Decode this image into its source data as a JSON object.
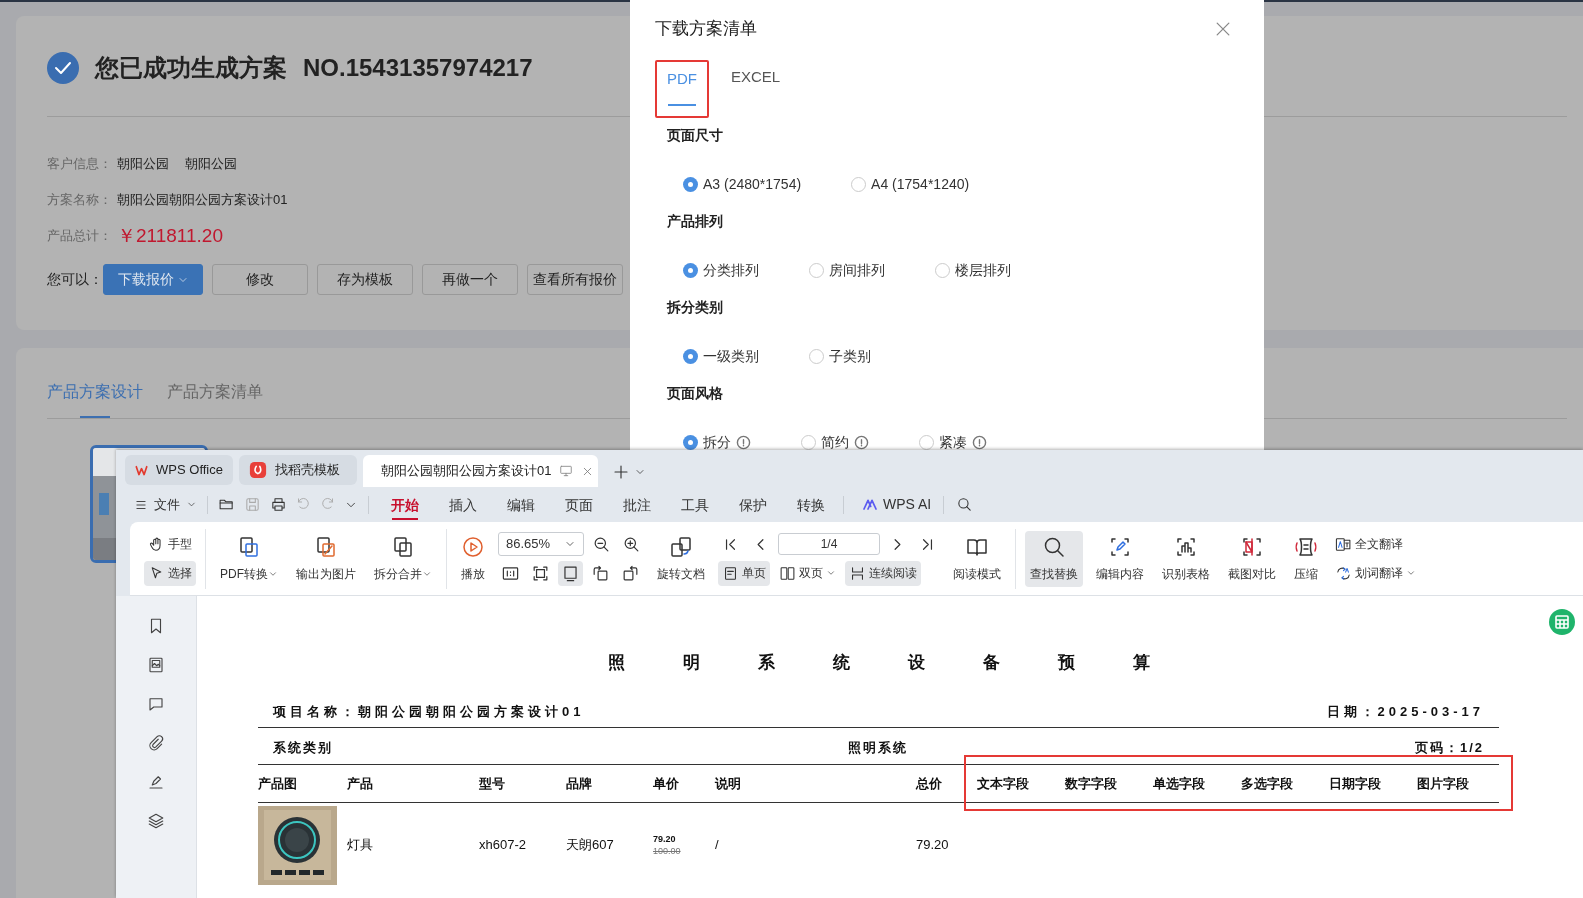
{
  "page": {
    "title": "您已成功生成方案",
    "number": "NO.15431357974217",
    "info": [
      {
        "label": "客户信息：",
        "kind": "text",
        "values": [
          "朝阳公园",
          "朝阳公园"
        ]
      },
      {
        "label": "方案名称：",
        "kind": "text",
        "values": [
          "朝阳公园朝阳公园方案设计01"
        ]
      },
      {
        "label": "产品总计：",
        "kind": "price",
        "values": [
          "￥211811.20"
        ]
      }
    ],
    "actions_label": "您可以：",
    "actions": [
      {
        "label": "下载报价",
        "kind": "primary",
        "dropdown": true
      },
      {
        "label": "修改",
        "kind": "default"
      },
      {
        "label": "存为模板",
        "kind": "default"
      },
      {
        "label": "再做一个",
        "kind": "default"
      },
      {
        "label": "查看所有报价",
        "kind": "default"
      }
    ],
    "tabs": [
      {
        "label": "产品方案设计",
        "selected": true
      },
      {
        "label": "产品方案清单",
        "selected": false
      }
    ]
  },
  "modal": {
    "title": "下载方案清单",
    "tabs": [
      {
        "label": "PDF",
        "selected": true,
        "highlighted": true
      },
      {
        "label": "EXCEL",
        "selected": false,
        "highlighted": false
      }
    ],
    "sections": [
      {
        "title": "页面尺寸",
        "options": [
          {
            "label": "A3 (2480*1754)",
            "selected": true
          },
          {
            "label": "A4 (1754*1240)",
            "selected": false
          }
        ]
      },
      {
        "title": "产品排列",
        "options": [
          {
            "label": "分类排列",
            "selected": true
          },
          {
            "label": "房间排列",
            "selected": false
          },
          {
            "label": "楼层排列",
            "selected": false
          }
        ]
      },
      {
        "title": "拆分类别",
        "options": [
          {
            "label": "一级类别",
            "selected": true
          },
          {
            "label": "子类别",
            "selected": false
          }
        ]
      },
      {
        "title": "页面风格",
        "options": [
          {
            "label": "拆分",
            "selected": true,
            "info": true
          },
          {
            "label": "简约",
            "selected": false,
            "info": true
          },
          {
            "label": "紧凑",
            "selected": false,
            "info": true
          }
        ]
      }
    ]
  },
  "viewer": {
    "tabs": [
      {
        "label": "WPS Office",
        "selected": false
      },
      {
        "label": "找稻壳模板",
        "selected": false
      },
      {
        "label": "朝阳公园朝阳公园方案设计01",
        "selected": true
      }
    ],
    "menu": {
      "file": "文件",
      "ai": "WPS AI",
      "tabs": [
        {
          "label": "开始",
          "selected": true
        },
        {
          "label": "插入",
          "selected": false
        },
        {
          "label": "编辑",
          "selected": false
        },
        {
          "label": "页面",
          "selected": false
        },
        {
          "label": "批注",
          "selected": false
        },
        {
          "label": "工具",
          "selected": false
        },
        {
          "label": "保护",
          "selected": false
        },
        {
          "label": "转换",
          "selected": false
        }
      ]
    },
    "toolbar": [
      {
        "items": [
          {
            "kind": "stack",
            "rows": [
              [
                {
                  "kind": "small",
                  "label": "手型",
                  "selected": false
                }
              ],
              [
                {
                  "kind": "small",
                  "label": "选择",
                  "selected": true
                }
              ]
            ]
          }
        ]
      },
      {
        "items": [
          {
            "kind": "big",
            "label": "PDF转换",
            "selected": false,
            "dropdown": true
          },
          {
            "kind": "big",
            "label": "输出为图片",
            "selected": false
          },
          {
            "kind": "big",
            "label": "拆分合并",
            "selected": false,
            "dropdown": true
          }
        ]
      },
      {
        "items": [
          {
            "kind": "big",
            "label": "播放",
            "selected": false
          },
          {
            "kind": "stack",
            "rows": [
              [
                {
                  "kind": "zoom_field",
                  "value": "86.65%"
                },
                {
                  "kind": "icon",
                  "selected": false
                },
                {
                  "kind": "icon",
                  "selected": false
                }
              ],
              [
                {
                  "kind": "icon",
                  "selected": false
                },
                {
                  "kind": "icon",
                  "selected": false
                },
                {
                  "kind": "icon",
                  "selected": true
                },
                {
                  "kind": "icon",
                  "selected": false
                },
                {
                  "kind": "icon",
                  "selected": false
                }
              ]
            ]
          },
          {
            "kind": "big",
            "label": "旋转文档",
            "selected": false
          },
          {
            "kind": "stack",
            "rows": [
              [
                {
                  "kind": "icon",
                  "selected": false
                },
                {
                  "kind": "icon",
                  "selected": false
                },
                {
                  "kind": "page_field",
                  "value": "1/4"
                },
                {
                  "kind": "icon",
                  "selected": false
                },
                {
                  "kind": "icon",
                  "selected": false
                }
              ],
              [
                {
                  "kind": "small",
                  "label": "单页",
                  "selected": true
                },
                {
                  "kind": "small",
                  "label": "双页",
                  "selected": false,
                  "dropdown": true
                },
                {
                  "kind": "small",
                  "label": "连续阅读",
                  "selected": true
                }
              ]
            ]
          },
          {
            "kind": "big",
            "label": "阅读模式",
            "selected": false
          }
        ]
      },
      {
        "items": [
          {
            "kind": "big",
            "label": "查找替换",
            "selected": true
          },
          {
            "kind": "big",
            "label": "编辑内容",
            "selected": false
          },
          {
            "kind": "big",
            "label": "识别表格",
            "selected": false
          },
          {
            "kind": "big",
            "label": "截图对比",
            "selected": false
          },
          {
            "kind": "big",
            "label": "压缩",
            "selected": false
          },
          {
            "kind": "stack",
            "rows": [
              [
                {
                  "kind": "small",
                  "label": "全文翻译",
                  "selected": false
                }
              ],
              [
                {
                  "kind": "small",
                  "label": "划词翻译",
                  "selected": false,
                  "dropdown": true
                }
              ]
            ]
          }
        ]
      }
    ],
    "document": {
      "title": "照明系统设备预算",
      "project": "项目名称：朝阳公园朝阳公园方案设计01",
      "date": "日期：2025-03-17",
      "category_label": "系统类别",
      "category": "照明系统",
      "page": "页码：1/2",
      "columns": [
        "产品图",
        "产品",
        "型号",
        "品牌",
        "单价",
        "说明",
        "总价",
        "文本字段",
        "数字字段",
        "单选字段",
        "多选字段",
        "日期字段",
        "图片字段"
      ],
      "fields_highlighted": true,
      "rows": [
        {
          "product": "灯具",
          "model": "xh607-2",
          "brand": "天朗607",
          "unit_price": "79.20",
          "original_price": "100.00",
          "note": "/",
          "total": "79.20"
        }
      ]
    }
  }
}
